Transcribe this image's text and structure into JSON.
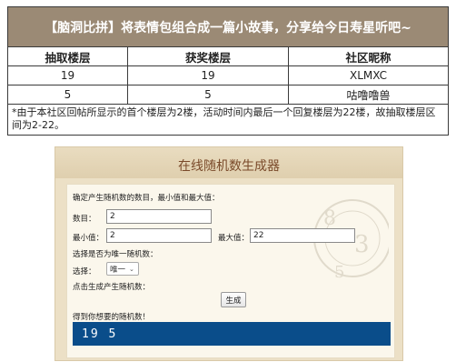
{
  "banner": {
    "title": "【脑洞比拼】将表情包组合成一篇小故事，分享给今日寿星听吧~"
  },
  "table": {
    "headers": [
      "抽取楼层",
      "获奖楼层",
      "社区昵称"
    ],
    "rows": [
      [
        "19",
        "19",
        "XLMXC"
      ],
      [
        "5",
        "5",
        "咕噜噜兽"
      ]
    ],
    "note": "*由于本社区回帖所显示的首个楼层为2楼，活动时间内最后一个回复楼层为22楼，故抽取楼层区间为2-22。"
  },
  "generator": {
    "title": "在线随机数生成器",
    "instruction": "确定产生随机数的数目，最小值和最大值：",
    "count_label": "数目：",
    "count_value": "2",
    "min_label": "最小值：",
    "min_value": "2",
    "max_label": "最大值：",
    "max_value": "22",
    "unique_prompt": "选择是否为唯一随机数：",
    "choice_label": "选择：",
    "choice_value": "唯一",
    "generate_prompt": "点击生成产生随机数：",
    "generate_button": "生成",
    "result_label": "得到你想要的随机数！",
    "result_value": "19 5"
  },
  "colors": {
    "banner_bg": "#9b8a75",
    "result_bg": "#0a4d8a",
    "panel_title": "#7a4a2a"
  }
}
